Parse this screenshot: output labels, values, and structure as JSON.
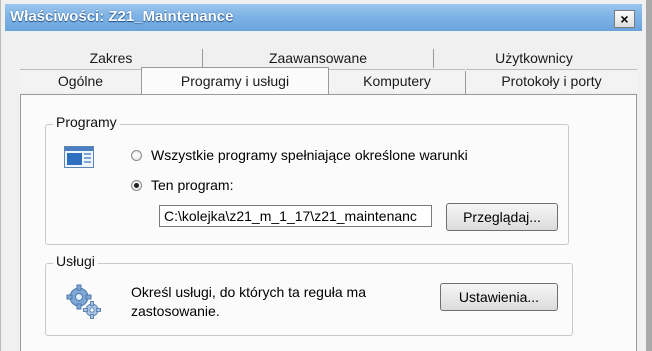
{
  "window": {
    "title": "Właściwości: Z21_Maintenance",
    "close_glyph": "×"
  },
  "tabs": {
    "row1": [
      "Zakres",
      "Zaawansowane",
      "Użytkownicy"
    ],
    "row2": [
      "Ogólne",
      "Programy i usługi",
      "Komputery",
      "Protokoły i porty"
    ],
    "active": "Programy i usługi"
  },
  "programs": {
    "group_label": "Programy",
    "icon": "window-app-icon",
    "option_all": "Wszystkie programy spełniające określone warunki",
    "option_this": "Ten program:",
    "selected": "option_this",
    "path_value": "C:\\kolejka\\z21_m_1_17\\z21_maintenanc",
    "browse_label": "Przeglądaj..."
  },
  "services": {
    "group_label": "Usługi",
    "icon": "gears-icon",
    "description_line1": "Określ usługi, do których ta reguła ma",
    "description_line2": "zastosowanie.",
    "settings_label": "Ustawienia..."
  }
}
